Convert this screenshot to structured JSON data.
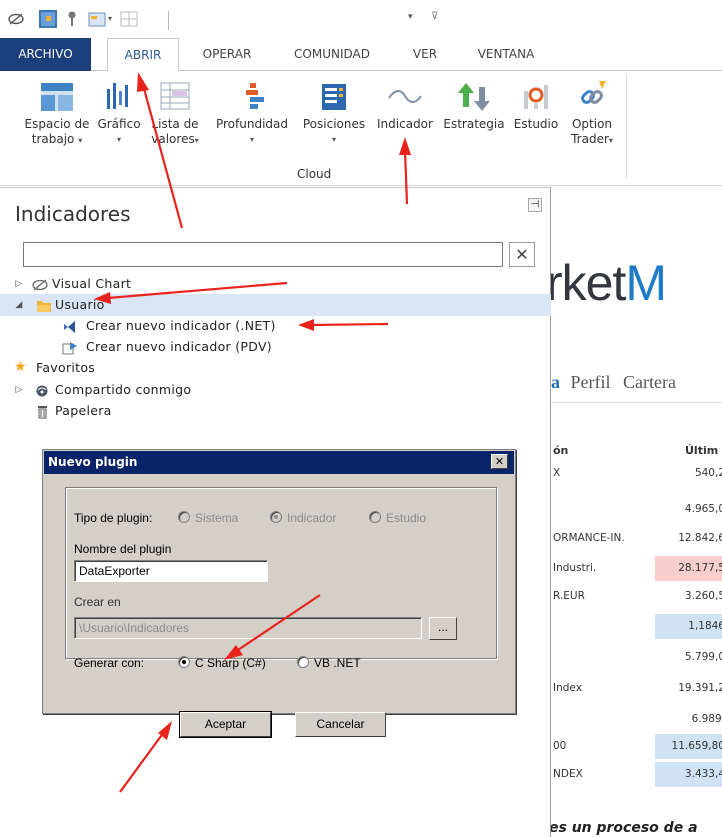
{
  "qat": {
    "combo_value": ""
  },
  "tabs": [
    {
      "label": "ARCHIVO"
    },
    {
      "label": "ABRIR"
    },
    {
      "label": "OPERAR"
    },
    {
      "label": "COMUNIDAD"
    },
    {
      "label": "VER"
    },
    {
      "label": "VENTANA"
    }
  ],
  "ribbon": {
    "buttons": [
      {
        "line1": "Espacio de",
        "line2": "trabajo"
      },
      {
        "line1": "Gráfico",
        "line2": ""
      },
      {
        "line1": "Lista de",
        "line2": "valores"
      },
      {
        "line1": "Profundidad",
        "line2": ""
      },
      {
        "line1": "Posiciones",
        "line2": ""
      },
      {
        "line1": "Indicador",
        "line2": ""
      },
      {
        "line1": "Estrategia",
        "line2": ""
      },
      {
        "line1": "Estudio",
        "line2": ""
      },
      {
        "line1": "Option",
        "line2": "Trader"
      }
    ],
    "group_label": "Cloud"
  },
  "panel": {
    "title": "Indicadores",
    "search_value": "",
    "tree": [
      {
        "label": "Visual Chart"
      },
      {
        "label": "Usuario"
      },
      {
        "label": "Crear nuevo indicador (.NET)"
      },
      {
        "label": "Crear nuevo indicador (PDV)"
      },
      {
        "label": "Favoritos"
      },
      {
        "label": "Compartido conmigo"
      },
      {
        "label": "Papelera"
      }
    ]
  },
  "dialog": {
    "title": "Nuevo plugin",
    "tipo_label": "Tipo de plugin:",
    "tipo_options": [
      "Sistema",
      "Indicador",
      "Estudio"
    ],
    "tipo_selected": "Indicador",
    "nombre_label": "Nombre del plugin",
    "nombre_value": "DataExporter",
    "crear_label": "Crear en",
    "crear_value": "\\Usuario\\Indicadores",
    "browse_label": "...",
    "generar_label": "Generar con:",
    "generar_options": [
      "C Sharp (C#)",
      "VB .NET"
    ],
    "generar_selected": "C Sharp (C#)",
    "ok_label": "Aceptar",
    "cancel_label": "Cancelar"
  },
  "site": {
    "brand_dark": "rket",
    "brand_blue": "M",
    "nav": [
      "a",
      "Perfil",
      "Cartera"
    ],
    "col_name": "ón",
    "col_last": "Últim",
    "rows": [
      {
        "name": "X",
        "value": "540,2"
      },
      {
        "name": "",
        "value": "4.965,0"
      },
      {
        "name": "ORMANCE-IN.",
        "value": "12.842,6"
      },
      {
        "name": "Industri.",
        "value": "28.177,5"
      },
      {
        "name": "R.EUR",
        "value": "3.260,5"
      },
      {
        "name": "",
        "value": "1,1846"
      },
      {
        "name": "",
        "value": "5.799,0"
      },
      {
        "name": "Index",
        "value": "19.391,2"
      },
      {
        "name": "",
        "value": "6.989,"
      },
      {
        "name": "00",
        "value": "11.659,80"
      },
      {
        "name": "NDEX",
        "value": "3.433,4"
      }
    ],
    "footer": "es un proceso de a"
  },
  "colors": {
    "file_tab": "#1c3f7c",
    "active_tab_text": "#2b5797",
    "selection": "#dbe6f5",
    "dialog_title": "#0a246a",
    "arrow": "#e8231d",
    "row_red": "#f7cdcd",
    "row_blue": "#cfe3f4"
  }
}
